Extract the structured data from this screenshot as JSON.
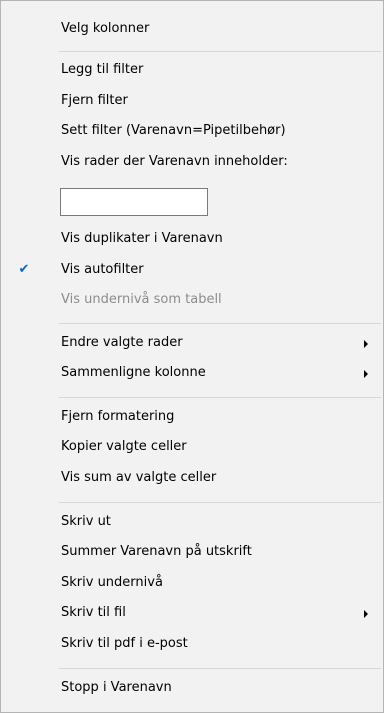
{
  "menu": {
    "items": [
      {
        "label": "Velg kolonner"
      },
      {
        "label": "Legg til filter"
      },
      {
        "label": "Fjern filter"
      },
      {
        "label": "Sett filter (Varenavn=Pipetilbehør)"
      },
      {
        "label": "Vis rader der Varenavn inneholder:"
      },
      {
        "label": "Vis duplikater i Varenavn"
      },
      {
        "label": "Vis autofilter",
        "checked": true
      },
      {
        "label": "Vis undernivå som tabell",
        "disabled": true
      },
      {
        "label": "Endre valgte rader",
        "submenu": true
      },
      {
        "label": "Sammenligne kolonne",
        "submenu": true
      },
      {
        "label": "Fjern formatering"
      },
      {
        "label": "Kopier valgte celler"
      },
      {
        "label": "Vis sum av valgte celler"
      },
      {
        "label": "Skriv ut"
      },
      {
        "label": "Summer Varenavn på utskrift"
      },
      {
        "label": "Skriv undernivå"
      },
      {
        "label": "Skriv til fil",
        "submenu": true
      },
      {
        "label": "Skriv til pdf i e-post"
      },
      {
        "label": "Stopp i Varenavn"
      }
    ],
    "filter_input": {
      "value": "",
      "placeholder": ""
    },
    "checkmark_glyph": "✔",
    "colors": {
      "background": "#f2f2f2",
      "checkmark": "#0a66c2",
      "disabled_text": "#8c8c8c"
    }
  }
}
